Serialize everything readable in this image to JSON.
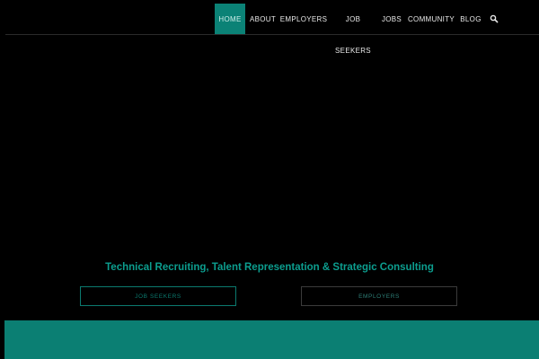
{
  "nav": {
    "items": [
      {
        "label": "HOME"
      },
      {
        "label": "ABOUT"
      },
      {
        "label": "EMPLOYERS"
      },
      {
        "label_top": "JOB",
        "label_bottom": "SEEKERS"
      },
      {
        "label": "JOBS"
      },
      {
        "label": "COMMUNITY"
      },
      {
        "label": "BLOG"
      }
    ],
    "search_icon": "search-icon"
  },
  "hero": {
    "headline": "Technical Recruiting, Talent Representation & Strategic Consulting",
    "buttons": [
      {
        "label": "JOB SEEKERS"
      },
      {
        "label": "EMPLOYERS"
      }
    ]
  },
  "colors": {
    "background": "#000000",
    "accent": "#0b8276",
    "headline": "#0c9e8f",
    "footer": "#0b7f73"
  }
}
